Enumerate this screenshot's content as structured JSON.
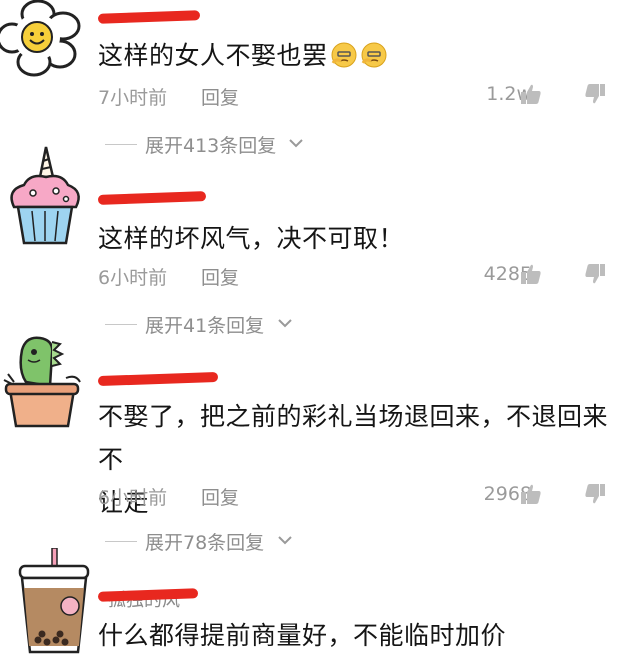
{
  "comments": [
    {
      "avatar": "flower-smiley-avatar",
      "text": "这样的女人不娶也罢",
      "emojis": [
        "thinking-face-emoji",
        "thinking-face-emoji"
      ],
      "time": "7小时前",
      "reply": "回复",
      "likes": "1.2w",
      "expand": "展开413条回复"
    },
    {
      "avatar": "unicorn-cupcake-avatar",
      "text": "这样的坏风气，决不可取！",
      "time": "6小时前",
      "reply": "回复",
      "likes": "4285",
      "expand": "展开41条回复"
    },
    {
      "avatar": "dinosaur-plant-avatar",
      "text_line1": "不娶了，把之前的彩礼当场退回来，不退回来不",
      "text_line2": "让走",
      "time": "6小时前",
      "reply": "回复",
      "likes": "2968",
      "expand": "展开78条回复"
    },
    {
      "avatar": "bubble-tea-avatar",
      "username": "孤独的风",
      "text": "什么都得提前商量好，不能临时加价"
    }
  ],
  "colors": {
    "redaction": "#e8281f",
    "meta_text": "#9a9a9a",
    "body_text": "#151515"
  },
  "icons": {
    "like": "thumbs-up-icon",
    "dislike": "thumbs-down-icon",
    "expand": "chevron-down-icon"
  }
}
